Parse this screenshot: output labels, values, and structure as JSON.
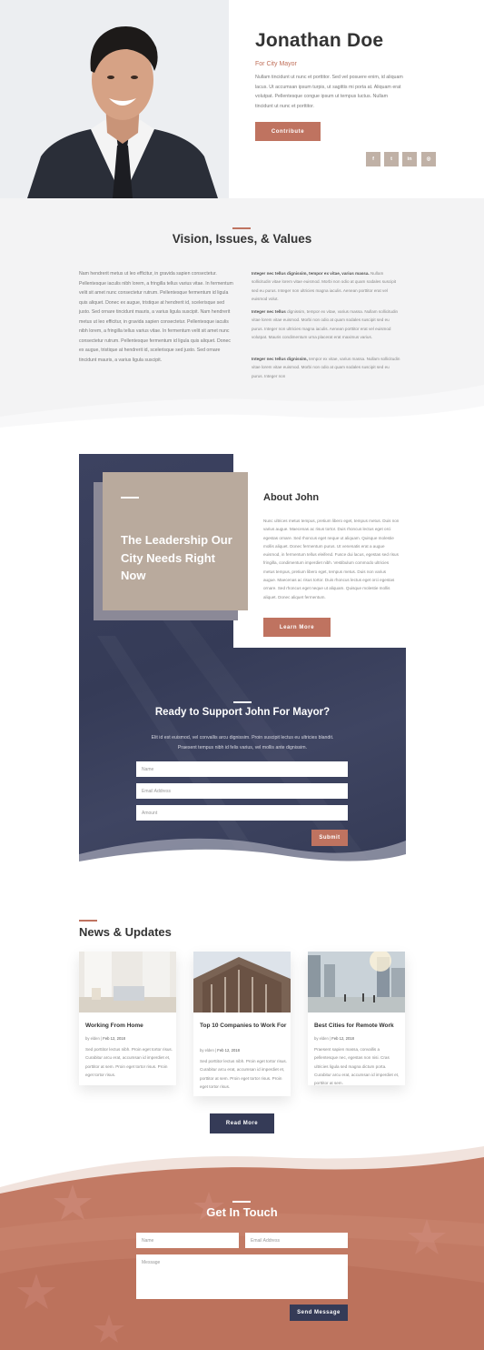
{
  "hero": {
    "name": "Jonathan Doe",
    "subtitle": "For City Mayor",
    "text": "Nullam tincidunt ut nunc et porttitor. Sed vel posuere enim, id aliquam lacus. Ut accumsan ipsum turpis, ut sagittis mi porta at. Aliquam erat volutpat. Pellentesque congue ipsum ut tempus luctus. Nullam tincidunt ut nunc et porttitor.",
    "contribute_label": "Contribute",
    "social": [
      {
        "icon": "facebook-icon",
        "glyph": "f"
      },
      {
        "icon": "twitter-icon",
        "glyph": "t"
      },
      {
        "icon": "linkedin-icon",
        "glyph": "in"
      },
      {
        "icon": "instagram-icon",
        "glyph": "◎"
      }
    ]
  },
  "vision": {
    "title": "Vision, Issues, & Values",
    "left_text": "Nam hendrerit metus ut leo efficitur, in gravida sapien consectetur. Pellentesque iaculis nibh lorem, a fringilla tellus varius vitae. In fermentum velit sit amet nunc consectetur rutrum. Pellentesque fermentum id ligula quis aliquet. Donec ex augue, tristique at hendrerit id, scelerisque sed justo. Sed ornare tincidunt mauris, a varius ligula suscipit. Nam hendrerit metus ut leo efficitur, in gravida sapien consectetur. Pellentesque iaculis nibh lorem, a fringilla tellus varius vitae. In fermentum velit sit amet nunc consectetur rutrum. Pellentesque fermentum id ligula quis aliquet. Donec ex augue, tristique at hendrerit id, scelerisque sed justo. Sed ornare tincidunt mauris, a varius ligula suscipit.",
    "right": [
      {
        "lead": "Integer nec tellus dignissim, tempor ex vitae, varius massa.",
        "body": " Nullam sollicitudin vitae lorem vitae euismod. Morbi non odio at quam sodales suscipit sed eu purus. Integer non ultricies magna iaculis. Aenean porttitor erat vel euismod volut."
      },
      {
        "lead": "Integer nec tellus",
        "body": " dignissim, tempor ex vitae, varius massa. Nullam sollicitudin vitae lorem vitae euismod. Morbi non odio at quam sodales suscipit sed eu purus. Integer non ultricies magna iaculis. Aenean porttitor erat vel euismod volutpat. Mauris condimentum urna placerat erat maximus varius."
      },
      {
        "lead": "Integer nec tellus dignissim,",
        "body": " tempor ex vitae, varius massa. Nullam sollicitudin vitae lorem vitae euismod. Morbi non odio at quam sodales suscipit sed eu purus. Integer non"
      }
    ]
  },
  "about": {
    "lead_text": "The Leadership Our City Needs Right Now",
    "title": "About John",
    "text": "Nunc ultrices metus tempus, pretium libero eget, tempus metus. Duis non varius augue. Maecenas ac risus tortor. Duis rhoncus lectus eget orci egestas ornare. Sed rhoncus eget neque ut aliquam. Quisque molestie mollis aliquet. Donec fermentum purus. Ut venenatis erat a augue euismod, in fermentum tellus eleifend. Fusce dui lacus, egestas sed risus fringilla, condimentum imperdiet nibh. Vestibulum commodo ultricies metus tempus, pretium libero eget, tempus metus. Duis non varius augue. Maecenas ac risus tortor. Duis rhoncus lectus eget orci egestas ornare. Sed rhoncus eget neque ut aliquam. Quisque molestie mollis aliquet. Donec aliquet fermentum.",
    "learn_more_label": "Learn More"
  },
  "support": {
    "title": "Ready to Support John For Mayor?",
    "text": "Elit id est euismod, vel convallis arcu dignissim. Proin suscipit lectus eu ultricies blandit. Praesent tempus nibh id felis varius, vel mollis ante dignissim.",
    "name_placeholder": "Name",
    "email_placeholder": "Email Address",
    "amount_placeholder": "Amount",
    "submit_label": "Submit"
  },
  "news": {
    "title": "News & Updates",
    "cards": [
      {
        "title": "Working From Home",
        "author": "by elden",
        "date": "Feb 12, 2018",
        "text": "Sed porttitor lectus nibh. Proin eget tortor risus. Curabitur arcu erat, accumsan id imperdiet et, porttitor at sem. Proin eget tortor risus. Proin eget tortor risus."
      },
      {
        "title": "Top 10 Companies to Work For",
        "author": "by elden",
        "date": "Feb 12, 2018",
        "text": "Sed porttitor lectus nibh. Proin eget tortor risus. Curabitur arcu erat, accumsan id imperdiet et, porttitor at sem. Proin eget tortor risus. Proin eget tortor risus."
      },
      {
        "title": "Best Cities for Remote Work",
        "author": "by elden",
        "date": "Feb 12, 2018",
        "text": "Praesent sapien massa, convallis a pellentesque nec, egestas non nisi. Cras ultricies ligula sed magna dictum porta. Curabitur arcu erat, accumsan id imperdiet et, porttitor at sem."
      }
    ],
    "read_more_label": "Read More"
  },
  "contact": {
    "title": "Get In Touch",
    "name_placeholder": "Name",
    "email_placeholder": "Email Address",
    "message_placeholder": "Message",
    "send_label": "Send Message"
  },
  "colors": {
    "accent": "#bf7360",
    "navy": "#353b57",
    "tan": "#b9aa9d"
  }
}
